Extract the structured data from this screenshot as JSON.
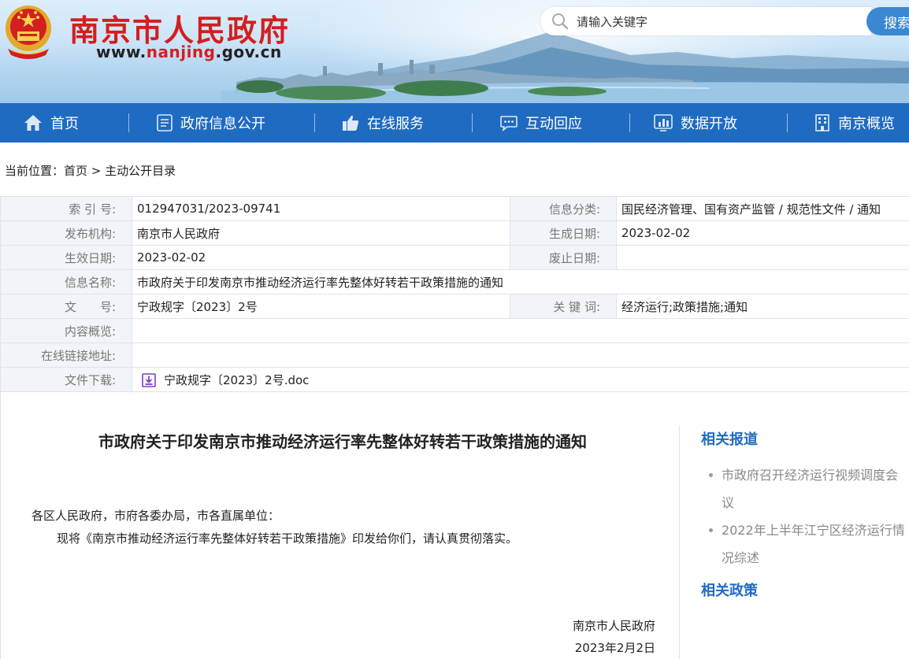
{
  "header": {
    "site_title": "南京市人民政府",
    "url_prefix": "www.",
    "url_highlight": "nanjing",
    "url_suffix": ".gov.cn",
    "search_placeholder": "请输入关键字",
    "search_button": "搜索"
  },
  "nav": {
    "items": [
      {
        "label": "首页",
        "icon": "home-icon"
      },
      {
        "label": "政府信息公开",
        "icon": "document-icon"
      },
      {
        "label": "在线服务",
        "icon": "thumbs-up-icon"
      },
      {
        "label": "互动回应",
        "icon": "chat-icon"
      },
      {
        "label": "数据开放",
        "icon": "bar-chart-icon"
      },
      {
        "label": "南京概览",
        "icon": "building-icon"
      }
    ]
  },
  "breadcrumb": {
    "prefix": "当前位置：",
    "home": "首页",
    "separator": " > ",
    "current": "主动公开目录"
  },
  "meta": {
    "index_label": "索 引 号:",
    "index_value": "012947031/2023-09741",
    "category_label": "信息分类:",
    "category_value": "国民经济管理、国有资产监管 / 规范性文件 / 通知",
    "publisher_label": "发布机构:",
    "publisher_value": "南京市人民政府",
    "created_label": "生成日期:",
    "created_value": "2023-02-02",
    "effective_label": "生效日期:",
    "effective_value": "2023-02-02",
    "expiry_label": "废止日期:",
    "expiry_value": "",
    "name_label": "信息名称:",
    "name_value": "市政府关于印发南京市推动经济运行率先整体好转若干政策措施的通知",
    "docno_label": "文　　号:",
    "docno_value": "宁政规字〔2023〕2号",
    "keywords_label": "关 键 词:",
    "keywords_value": "经济运行;政策措施;通知",
    "summary_label": "内容概览:",
    "summary_value": "",
    "link_label": "在线链接地址:",
    "link_value": "",
    "download_label": "文件下载:",
    "download_file": "宁政规字〔2023〕2号.doc"
  },
  "article": {
    "title": "市政府关于印发南京市推动经济运行率先整体好转若干政策措施的通知",
    "salutation": "各区人民政府，市府各委办局，市各直属单位：",
    "paragraph": "现将《南京市推动经济运行率先整体好转若干政策措施》印发给你们，请认真贯彻落实。",
    "signer": "南京市人民政府",
    "date": "2023年2月2日"
  },
  "sidebar": {
    "related_reports_heading": "相关报道",
    "related_reports": [
      "市政府召开经济运行视频调度会议",
      "2022年上半年江宁区经济运行情况综述"
    ],
    "related_policies_heading": "相关政策"
  },
  "colors": {
    "brand_red": "#d31f1f",
    "nav_blue": "#1f6bc2",
    "search_blue": "#3a87d2",
    "label_bg": "#f1f4f8"
  }
}
